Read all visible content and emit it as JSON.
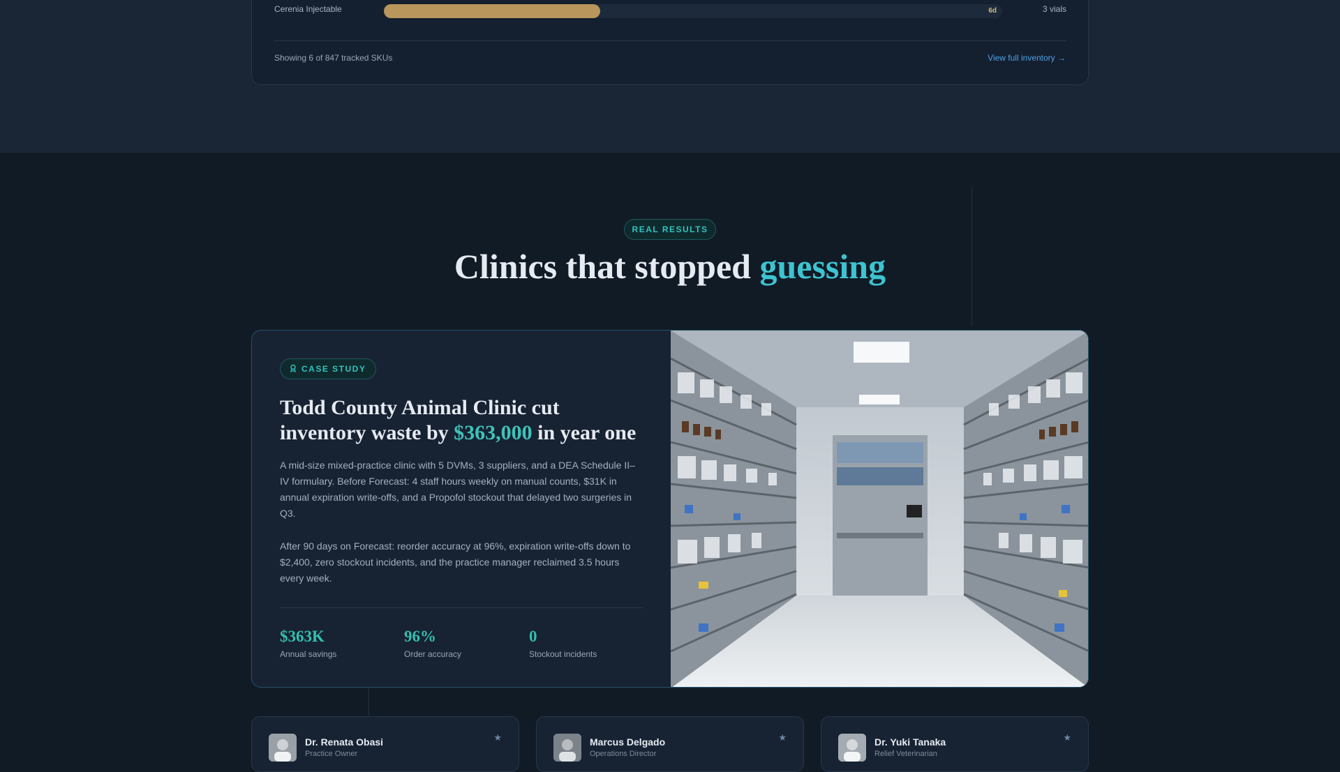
{
  "inventory": {
    "item": {
      "name": "Cerenia Injectable",
      "days_left": "6d",
      "quantity": "3 vials",
      "fill_fraction": 0.35
    },
    "footer_text": "Showing 6 of 847 tracked SKUs",
    "link_text": "View full inventory →"
  },
  "results": {
    "pill": "REAL RESULTS",
    "heading_plain": "Clinics that stopped ",
    "heading_accent": "guessing"
  },
  "case_study": {
    "badge": "CASE STUDY",
    "badge_icon": "award-icon",
    "title_part1": "Todd County Animal Clinic cut inventory waste by ",
    "title_money": "$363,000",
    "title_part2": " in year one",
    "paragraph1": "A mid-size mixed-practice clinic with 5 DVMs, 3 suppliers, and a DEA Schedule II–IV formulary. Before Forecast: 4 staff hours weekly on manual counts, $31K in annual expiration write-offs, and a Propofol stockout that delayed two surgeries in Q3.",
    "paragraph2": "After 90 days on Forecast: reorder accuracy at 96%, expiration write-offs down to $2,400, zero stockout incidents, and the practice manager reclaimed 3.5 hours every week.",
    "stats": [
      {
        "value": "$363K",
        "label": "Annual savings"
      },
      {
        "value": "96%",
        "label": "Order accuracy"
      },
      {
        "value": "0",
        "label": "Stockout incidents"
      }
    ]
  },
  "testimonials": [
    {
      "name": "Dr. Renata Obasi",
      "role": "Practice Owner"
    },
    {
      "name": "Marcus Delgado",
      "role": "Operations Director"
    },
    {
      "name": "Dr. Yuki Tanaka",
      "role": "Relief Veterinarian"
    }
  ],
  "colors": {
    "accent": "#3ec3d0",
    "gold": "#b9965c",
    "teal": "#35bfae"
  }
}
